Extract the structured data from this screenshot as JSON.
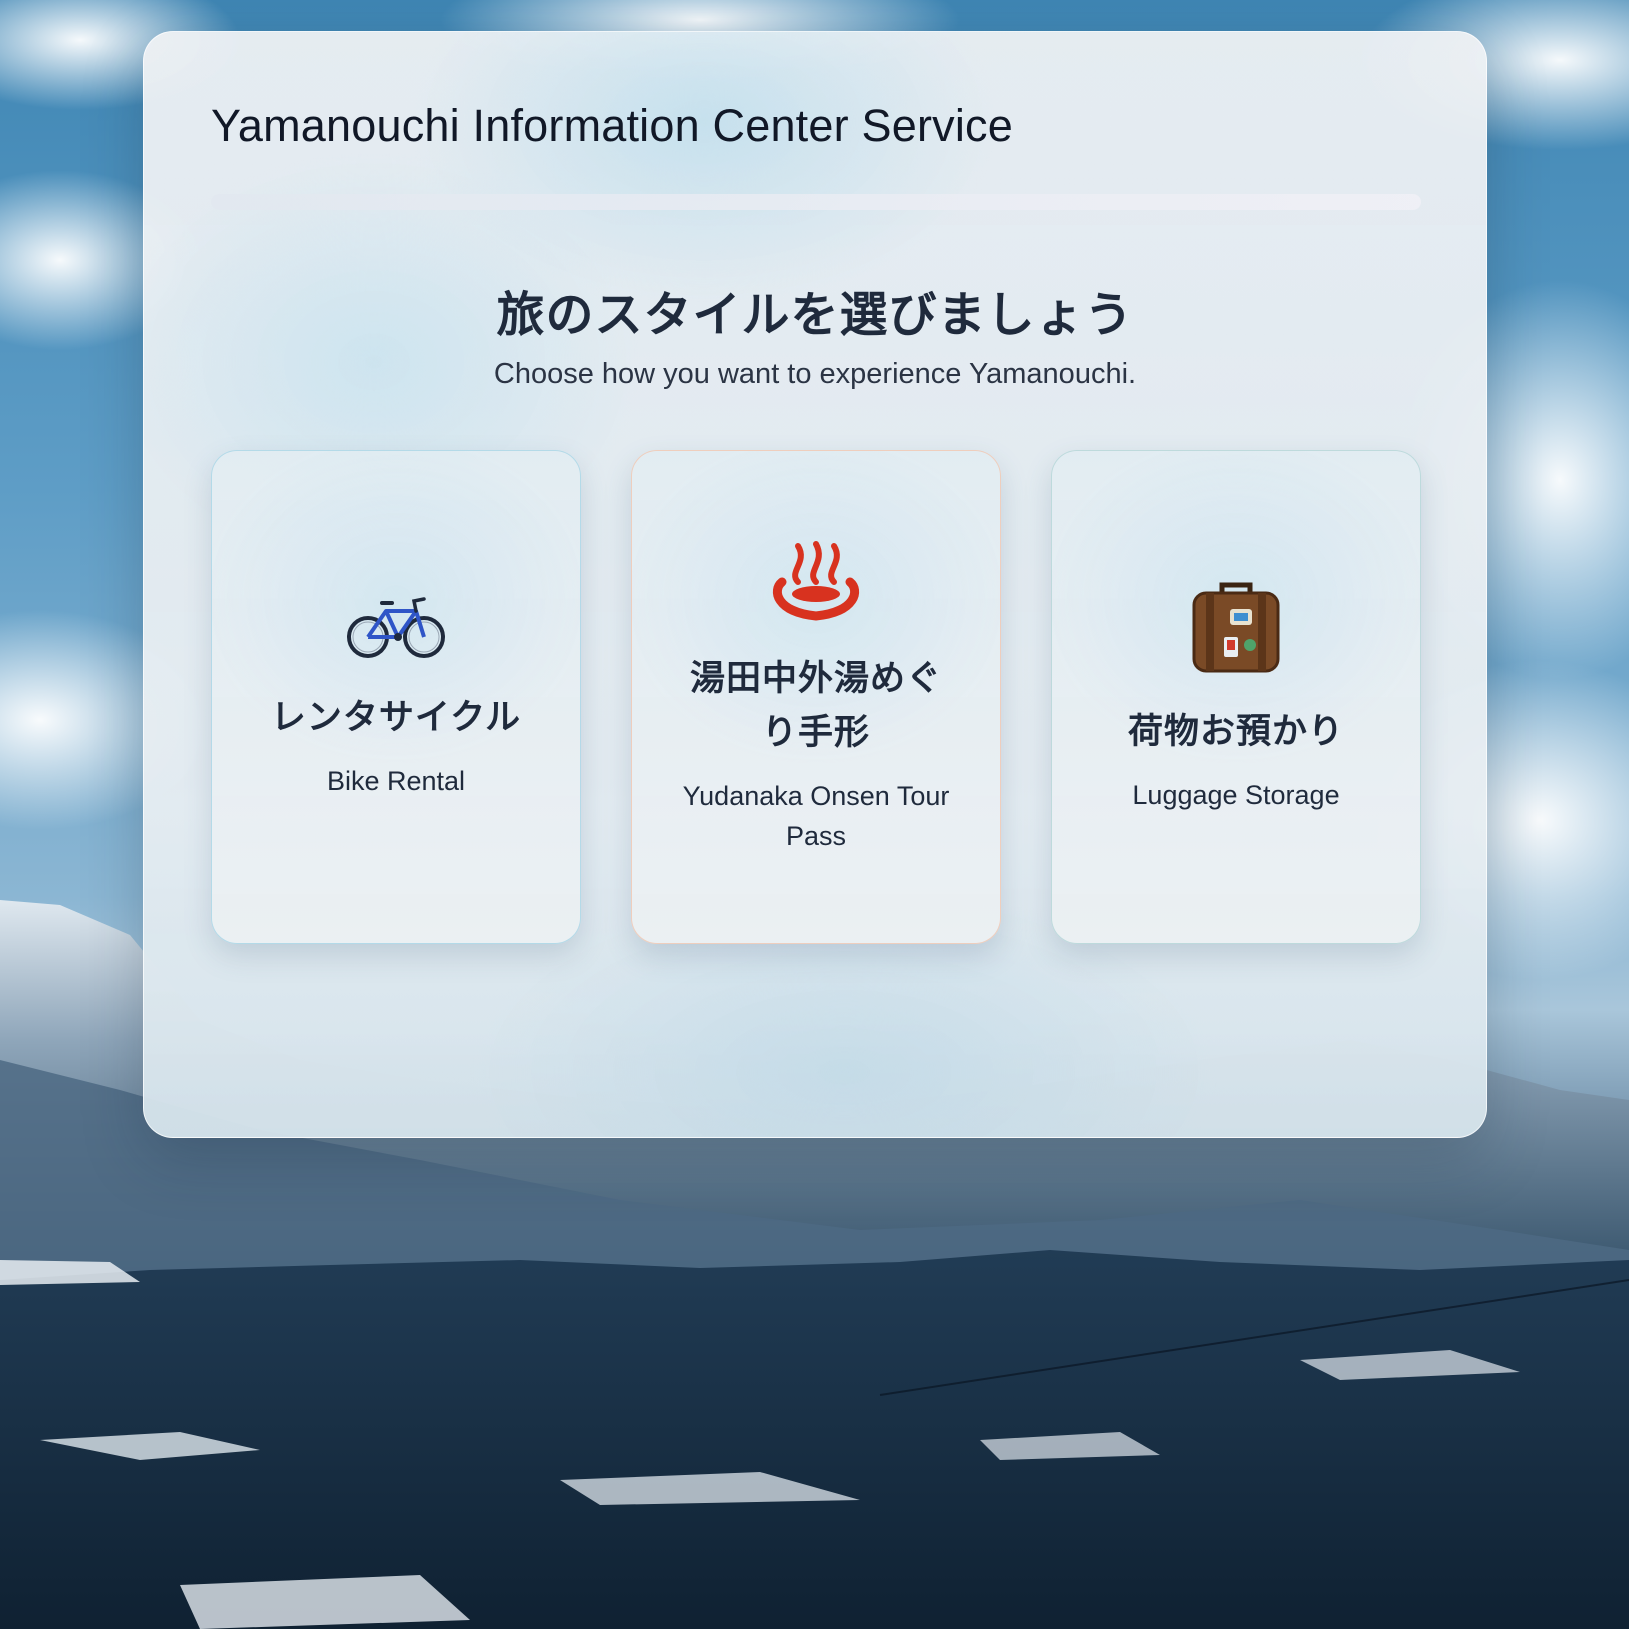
{
  "header": {
    "title": "Yamanouchi Information Center Service"
  },
  "main": {
    "heading": "旅のスタイルを選びましょう",
    "subheading": "Choose how you want to experience Yamanouchi."
  },
  "options": [
    {
      "icon": "bicycle-icon",
      "title": "レンタサイクル",
      "subtitle": "Bike Rental"
    },
    {
      "icon": "hot-springs-icon",
      "title": "湯田中外湯めぐり手形",
      "subtitle": "Yudanaka Onsen Tour Pass"
    },
    {
      "icon": "luggage-icon",
      "title": "荷物お預かり",
      "subtitle": "Luggage Storage"
    }
  ],
  "colors": {
    "text_primary": "#1f2a3c",
    "title_text": "#111827",
    "onsen_red": "#d8321f",
    "bike_blue": "#2f55c7",
    "luggage_brown": "#7a4a26"
  }
}
